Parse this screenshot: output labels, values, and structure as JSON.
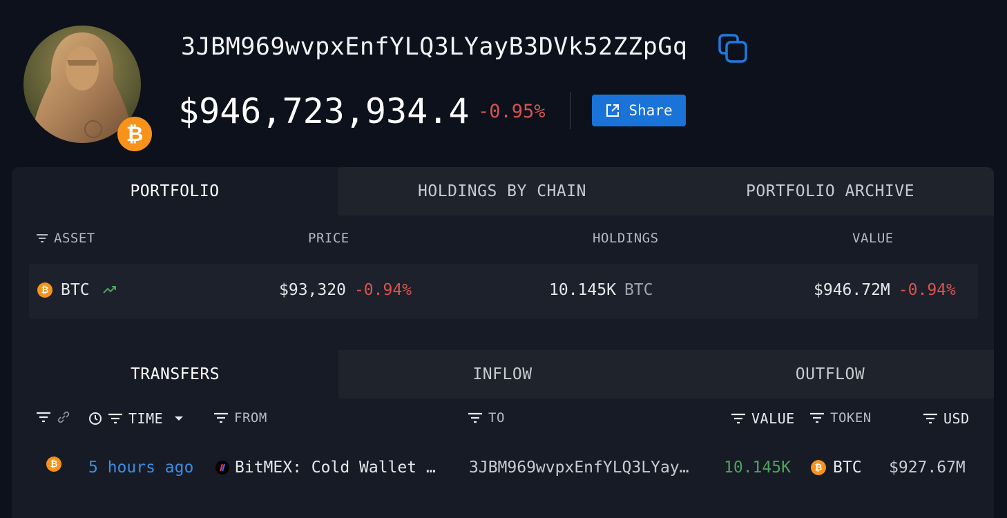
{
  "profile": {
    "address": "3JBM969wvpxEnfYLQ3LYayB3DVk52ZZpGq",
    "balance": "$946,723,934.4",
    "balance_change": "-0.95%",
    "share_label": "Share",
    "badge_icon": "btc-icon"
  },
  "portfolio_tabs": [
    {
      "label": "PORTFOLIO",
      "active": true
    },
    {
      "label": "HOLDINGS BY CHAIN",
      "active": false
    },
    {
      "label": "PORTFOLIO ARCHIVE",
      "active": false
    }
  ],
  "portfolio_columns": {
    "asset": "ASSET",
    "price": "PRICE",
    "holdings": "HOLDINGS",
    "value": "VALUE"
  },
  "portfolio_rows": [
    {
      "asset": "BTC",
      "price": "$93,320",
      "price_change": "-0.94%",
      "holdings": "10.145K",
      "holdings_unit": "BTC",
      "value": "$946.72M",
      "value_change": "-0.94%"
    }
  ],
  "transfer_tabs": [
    {
      "label": "TRANSFERS",
      "active": true
    },
    {
      "label": "INFLOW",
      "active": false
    },
    {
      "label": "OUTFLOW",
      "active": false
    }
  ],
  "transfer_columns": {
    "time": "TIME",
    "from": "FROM",
    "to": "TO",
    "value": "VALUE",
    "token": "TOKEN",
    "usd": "USD"
  },
  "transfer_rows": [
    {
      "time": "5 hours ago",
      "from": "BitMEX: Cold Wallet …",
      "to": "3JBM969wvpxEnfYLQ3LYay…",
      "value": "10.145K",
      "token": "BTC",
      "usd": "$927.67M"
    }
  ],
  "colors": {
    "background": "#0c111c",
    "panel": "#171b25",
    "accent_blue": "#1a73d9",
    "negative": "#d9534f",
    "positive": "#4fa35a",
    "btc_orange": "#f7931a"
  }
}
